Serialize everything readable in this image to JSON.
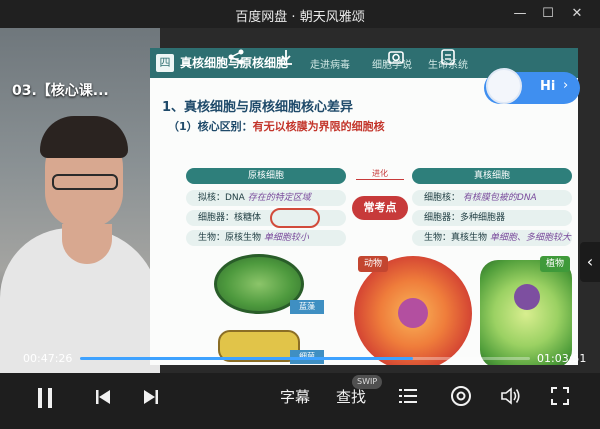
{
  "window": {
    "title": "百度网盘 · 朝天风雅颂",
    "minimize_glyph": "—",
    "maximize_glyph": "☐",
    "close_glyph": "✕"
  },
  "video": {
    "lesson_title": "03.【核心课...",
    "slide": {
      "section_number": "四",
      "tabs": [
        "真核细胞与原核细胞",
        "走进病毒",
        "细胞学说",
        "生命系统"
      ],
      "heading": "1、真核细胞与原核细胞核心差异",
      "sub_prefix": "（1）核心区别：",
      "sub_highlight": "有无以核膜为界限的细胞核",
      "evolve_label": "进化",
      "center_badge": "常考点",
      "left_header": "原核细胞",
      "right_header": "真核细胞",
      "left_rows": [
        {
          "text": "拟核：DNA",
          "note": "存在的特定区域"
        },
        {
          "text": "细胞器：核糖体",
          "note": ""
        },
        {
          "text": "生物：原核生物",
          "note": "单细胞较小"
        }
      ],
      "right_rows": [
        {
          "text": "细胞核：",
          "note": "有核膜包被的DNA"
        },
        {
          "text": "细胞器：多种细胞器",
          "note": ""
        },
        {
          "text": "生物：真核生物",
          "note": "单细胞、多细胞较大"
        }
      ],
      "bio_tags": [
        "蓝藻",
        "细菌"
      ],
      "cell_tags": [
        "动物",
        "植物"
      ]
    },
    "ai_assistant": {
      "label": "Hi",
      "arrow": "›"
    },
    "side_arrow": "‹"
  },
  "playback": {
    "current_time": "00:47:26",
    "total_time": "01:03:51",
    "progress": 0.74,
    "accent": "#3ea2ff"
  },
  "controls": {
    "subtitle_label": "字幕",
    "search_label": "查找",
    "swip_badge": "SWIP"
  },
  "icons": [
    "play-pause-icon",
    "previous-icon",
    "next-icon",
    "playlist-icon",
    "speed-icon",
    "volume-icon",
    "fullscreen-icon",
    "share-icon",
    "download-icon",
    "snapshot-icon",
    "note-icon"
  ]
}
